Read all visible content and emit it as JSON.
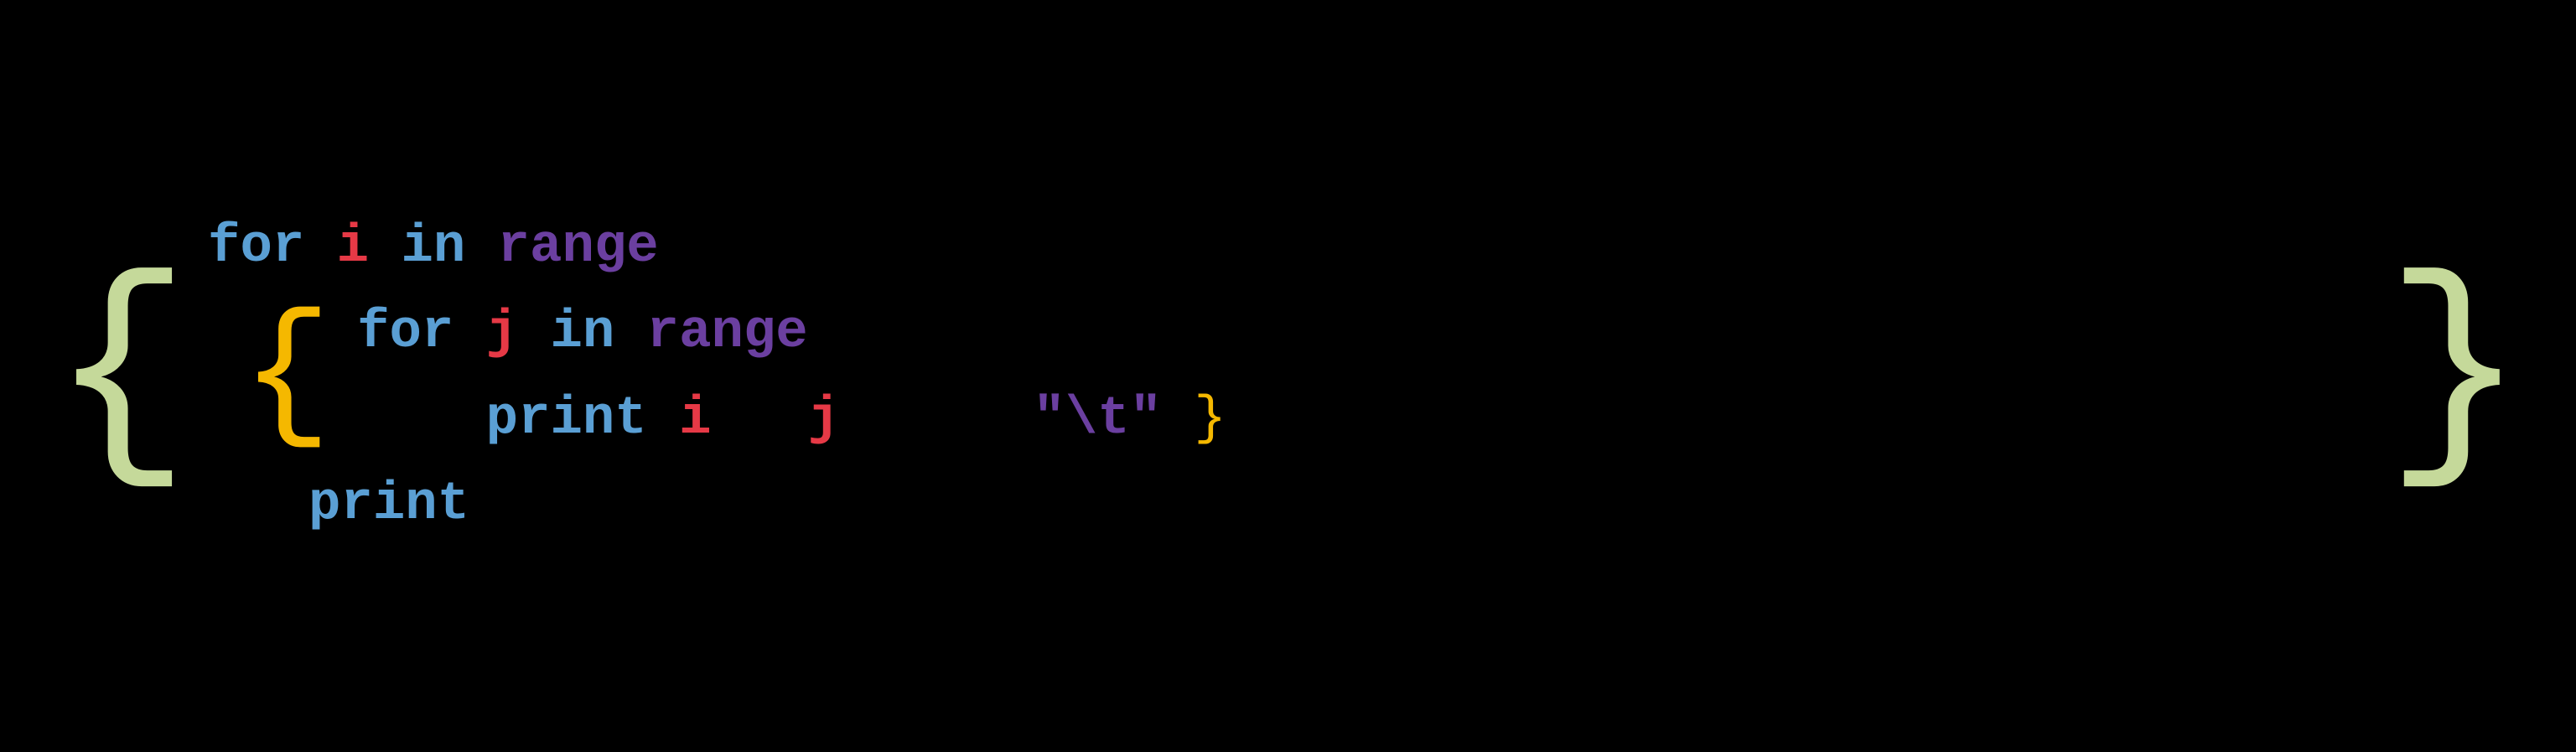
{
  "code": {
    "line1": {
      "for": "for",
      "var": "i",
      "in": "in",
      "range": "range"
    },
    "line2": {
      "for": "for",
      "var": "j",
      "in": "in",
      "range": "range"
    },
    "line3": {
      "print": "print",
      "var1": "i",
      "var2": "j",
      "string": "\"\\t\""
    },
    "line4": {
      "print": "print"
    }
  },
  "braces": {
    "outer_left": "{",
    "outer_right": "}",
    "inner_left": "{",
    "inner_right": "}"
  }
}
